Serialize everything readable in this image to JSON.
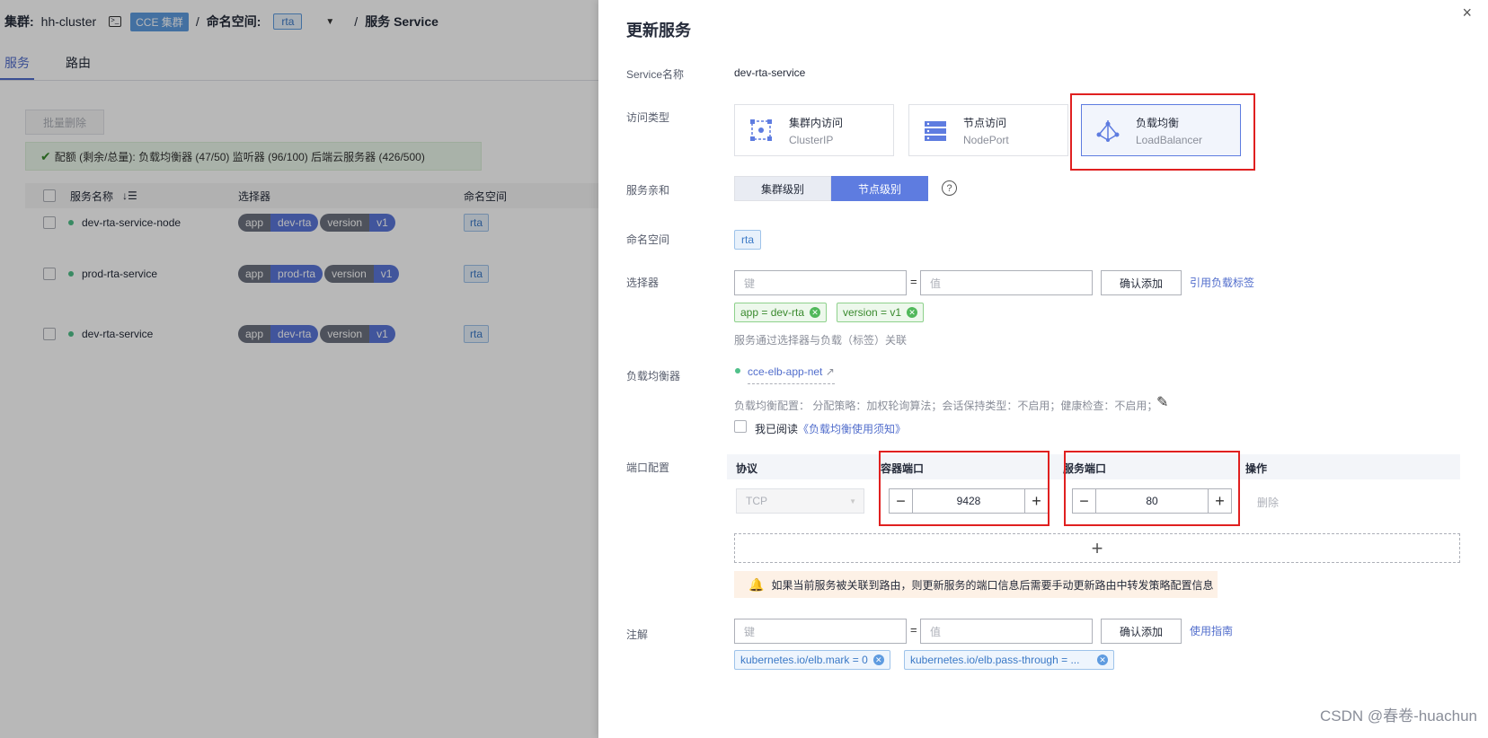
{
  "topbar": {
    "cluster_label": "集群:",
    "cluster_name": "hh-cluster",
    "cluster_tag": "CCE 集群",
    "sep": "/",
    "namespace_label": "命名空间:",
    "namespace_value": "rta",
    "page_label": "服务 Service"
  },
  "tabs": [
    "服务",
    "路由"
  ],
  "list": {
    "batch_delete": "批量删除",
    "quota_text": "配额 (剩余/总量): 负载均衡器 (47/50)  监听器 (96/100)  后端云服务器 (426/500)",
    "headers": {
      "name": "服务名称",
      "selector": "选择器",
      "namespace": "命名空间"
    },
    "rows": [
      {
        "name": "dev-rta-service-node",
        "k1": "app",
        "v1": "dev-rta",
        "k2": "version",
        "v2": "v1",
        "ns": "rta"
      },
      {
        "name": "prod-rta-service",
        "k1": "app",
        "v1": "prod-rta",
        "k2": "version",
        "v2": "v1",
        "ns": "rta"
      },
      {
        "name": "dev-rta-service",
        "k1": "app",
        "v1": "dev-rta",
        "k2": "version",
        "v2": "v1",
        "ns": "rta"
      }
    ]
  },
  "drawer": {
    "title": "更新服务",
    "close": "×",
    "service_name_label": "Service名称",
    "service_name": "dev-rta-service",
    "access_type_label": "访问类型",
    "access_types": [
      {
        "title": "集群内访问",
        "sub": "ClusterIP"
      },
      {
        "title": "节点访问",
        "sub": "NodePort"
      },
      {
        "title": "负载均衡",
        "sub": "LoadBalancer"
      }
    ],
    "affinity_label": "服务亲和",
    "affinity_options": [
      "集群级别",
      "节点级别"
    ],
    "help": "?",
    "namespace_label": "命名空间",
    "namespace": "rta",
    "selector_label": "选择器",
    "key_placeholder": "键",
    "value_placeholder": "值",
    "eq": "=",
    "confirm_add": "确认添加",
    "ref_labels_link": "引用负载标签",
    "selector_chips": [
      "app  = dev-rta",
      "version  = v1"
    ],
    "selector_hint": "服务通过选择器与负载（标签）关联",
    "lb_label": "负载均衡器",
    "lb_name": "cce-elb-app-net",
    "lb_config": "负载均衡配置：  分配策略：加权轮询算法；会话保持类型：不启用；健康检查：不启用；",
    "read_text": "我已阅读",
    "read_link": "《负载均衡使用须知》",
    "port_label": "端口配置",
    "port_headers": {
      "protocol": "协议",
      "container_port": "容器端口",
      "service_port": "服务端口",
      "action": "操作"
    },
    "protocol": "TCP",
    "container_port": "9428",
    "service_port": "80",
    "delete": "删除",
    "add": "+",
    "warning": "如果当前服务被关联到路由，则更新服务的端口信息后需要手动更新路由中转发策略配置信息",
    "annotation_label": "注解",
    "usage_guide": "使用指南",
    "annotation_chips": [
      "kubernetes.io/elb.mark  = 0",
      "kubernetes.io/elb.pass-through  = ..."
    ]
  },
  "watermark": "CSDN @春卷-huachun"
}
